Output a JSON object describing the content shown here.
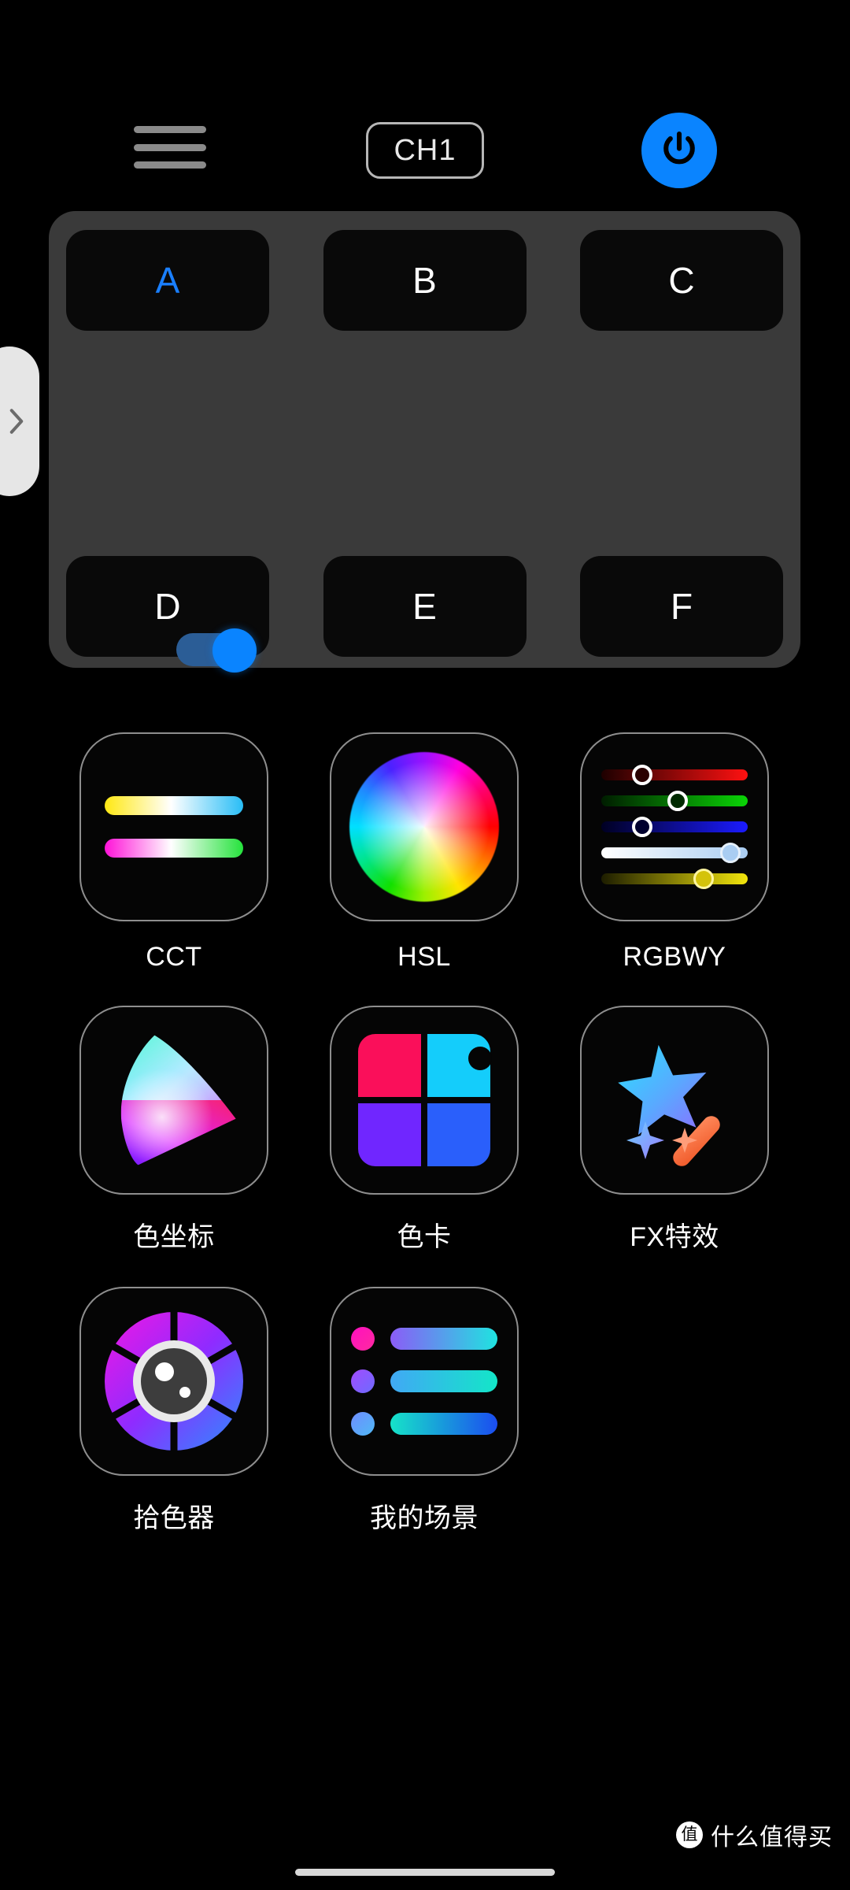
{
  "app": {
    "background_color": "#000000",
    "accent_color": "#0a84ff"
  },
  "header": {
    "menu_icon": "hamburger-menu-icon",
    "channel_label": "CH1",
    "power_icon": "power-icon",
    "power_state": "on",
    "power_color": "#0a84ff"
  },
  "edge_tab": {
    "icon": "chevron-right-icon",
    "color": "#e6e6e6"
  },
  "presets": {
    "panel_color": "#3a3a3a",
    "active_color": "#1a7fff",
    "row1": [
      {
        "label": "A",
        "active": true
      },
      {
        "label": "B",
        "active": false
      },
      {
        "label": "C",
        "active": false
      }
    ],
    "row2": [
      {
        "label": "D",
        "active": false
      },
      {
        "label": "E",
        "active": false
      },
      {
        "label": "F",
        "active": false
      }
    ],
    "toggle": {
      "name": "preset-toggle",
      "state": "on",
      "knob_color": "#0a84ff",
      "track_color": "#2b5d96"
    }
  },
  "modes": [
    {
      "id": "cct",
      "label": "CCT",
      "icon": "cct-bars-icon"
    },
    {
      "id": "hsl",
      "label": "HSL",
      "icon": "color-wheel-icon"
    },
    {
      "id": "rgbwy",
      "label": "RGBWY",
      "icon": "rgbwy-sliders-icon"
    },
    {
      "id": "xy",
      "label": "色坐标",
      "icon": "cie-chromaticity-icon"
    },
    {
      "id": "swatch",
      "label": "色卡",
      "icon": "color-swatch-grid-icon"
    },
    {
      "id": "fx",
      "label": "FX特效",
      "icon": "magic-wand-icon"
    },
    {
      "id": "picker",
      "label": "拾色器",
      "icon": "camera-aperture-icon"
    },
    {
      "id": "scenes",
      "label": "我的场景",
      "icon": "scene-list-icon"
    }
  ],
  "rgbwy_sliders": [
    {
      "channel": "R",
      "value": 28,
      "color": "#ff1111"
    },
    {
      "channel": "G",
      "value": 52,
      "color": "#0ad406"
    },
    {
      "channel": "B",
      "value": 28,
      "color": "#1b1bff"
    },
    {
      "channel": "W",
      "value": 88,
      "color": "#a9cdf2"
    },
    {
      "channel": "Y",
      "value": 70,
      "color": "#f2e50c"
    }
  ],
  "swatch_colors": {
    "top_left": "#fa0f5a",
    "top_right": "#14cdfb",
    "bottom_left": "#7026ff",
    "bottom_right": "#2a5ffb"
  },
  "watermark": {
    "badge": "值",
    "text": "什么值得买"
  }
}
